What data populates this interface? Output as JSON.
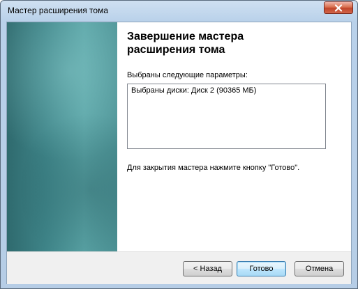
{
  "window": {
    "title": "Мастер расширения тома"
  },
  "wizard": {
    "heading_line1": "Завершение мастера",
    "heading_line2": "расширения тома",
    "params_label": "Выбраны следующие параметры:",
    "params_text": "Выбраны диски: Диск 2 (90365 МБ)",
    "finish_hint": "Для закрытия мастера нажмите кнопку \"Готово\"."
  },
  "buttons": {
    "back": "< Назад",
    "finish": "Готово",
    "cancel": "Отмена"
  },
  "icons": {
    "close": "close-icon"
  },
  "colors": {
    "side_panel": "#3e8488",
    "close_button": "#c0452a",
    "default_button_border": "#3c7fb1"
  }
}
